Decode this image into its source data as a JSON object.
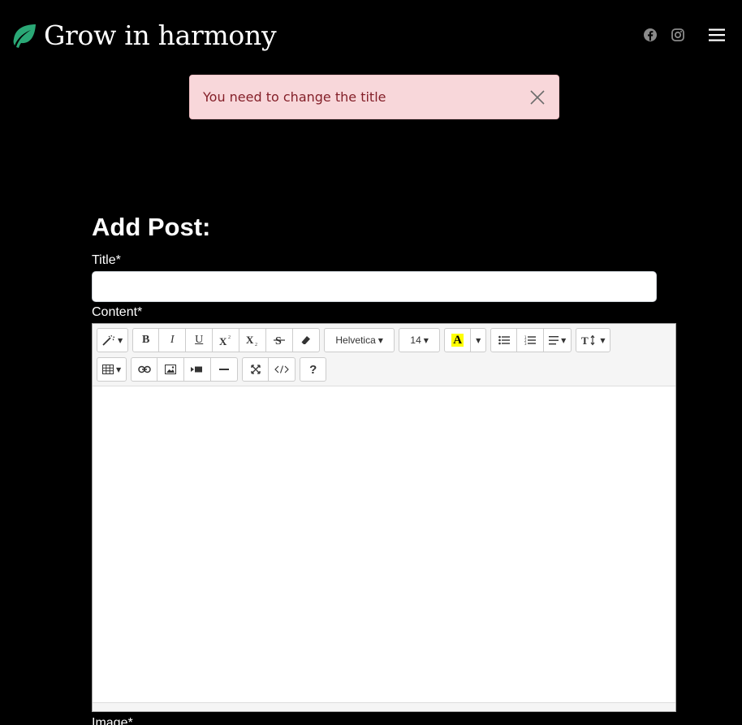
{
  "brand": {
    "name": "Grow in harmony",
    "icon": "leaf-icon",
    "color": "#2aa876"
  },
  "nav": {
    "social_icons": [
      "facebook-icon",
      "instagram-icon"
    ],
    "menu_icon": "hamburger-menu-icon"
  },
  "alert": {
    "message": "You need to change the title",
    "type": "danger",
    "close_icon": "close-icon"
  },
  "form": {
    "heading": "Add Post:",
    "title_label": "Title*",
    "title_value": "",
    "content_label": "Content*",
    "image_label": "Image*"
  },
  "editor": {
    "font_name": "Helvetica",
    "font_size": "14",
    "highlight_color": "#ffff00",
    "toolbar_row1": [
      "magic-style",
      "bold",
      "italic",
      "underline",
      "superscript",
      "subscript",
      "strikethrough",
      "eraser",
      "font-name",
      "font-size",
      "text-color",
      "color-dropdown",
      "unordered-list",
      "ordered-list",
      "paragraph-align",
      "line-height"
    ],
    "toolbar_row2": [
      "table",
      "link",
      "picture",
      "video",
      "horizontal-rule",
      "fullscreen",
      "code-view",
      "help"
    ],
    "labels": {
      "bold": "B",
      "italic": "I",
      "underline": "U",
      "color_letter": "A",
      "help": "?"
    }
  }
}
